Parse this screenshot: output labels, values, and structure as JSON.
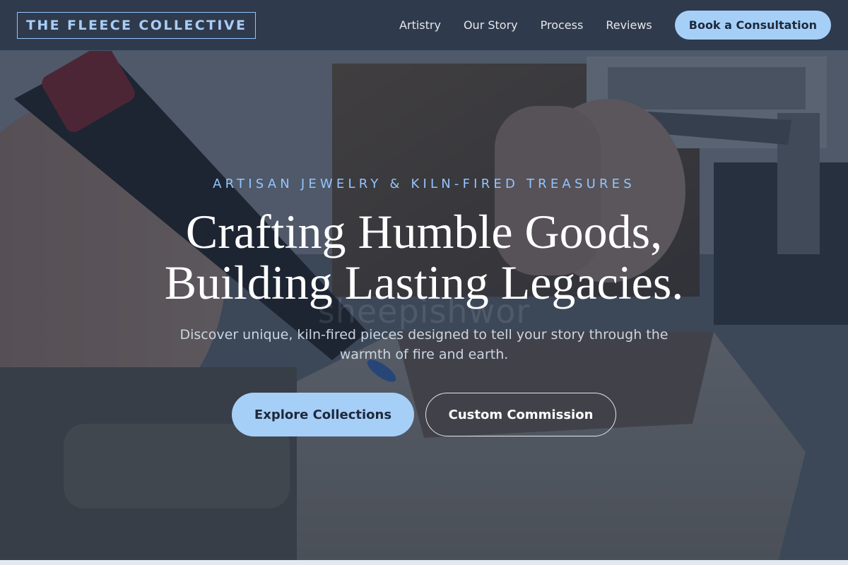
{
  "nav": {
    "brand": "THE FLEECE COLLECTIVE",
    "links": [
      "Artistry",
      "Our Story",
      "Process",
      "Reviews"
    ],
    "cta": "Book a Consultation"
  },
  "hero": {
    "eyebrow": "ARTISAN JEWELRY & KILN-FIRED TREASURES",
    "headline_line1": "Crafting Humble Goods,",
    "headline_line2": "Building Lasting Legacies.",
    "subtext": "Discover unique, kiln-fired pieces designed to tell your story through the warmth of fire and earth.",
    "watermark": "sheepishwor",
    "primary_button": "Explore Collections",
    "secondary_button": "Custom Commission"
  },
  "colors": {
    "accent": "#a6cff8",
    "nav_bg": "#2f3a4c",
    "overlay": "#1e293b"
  }
}
